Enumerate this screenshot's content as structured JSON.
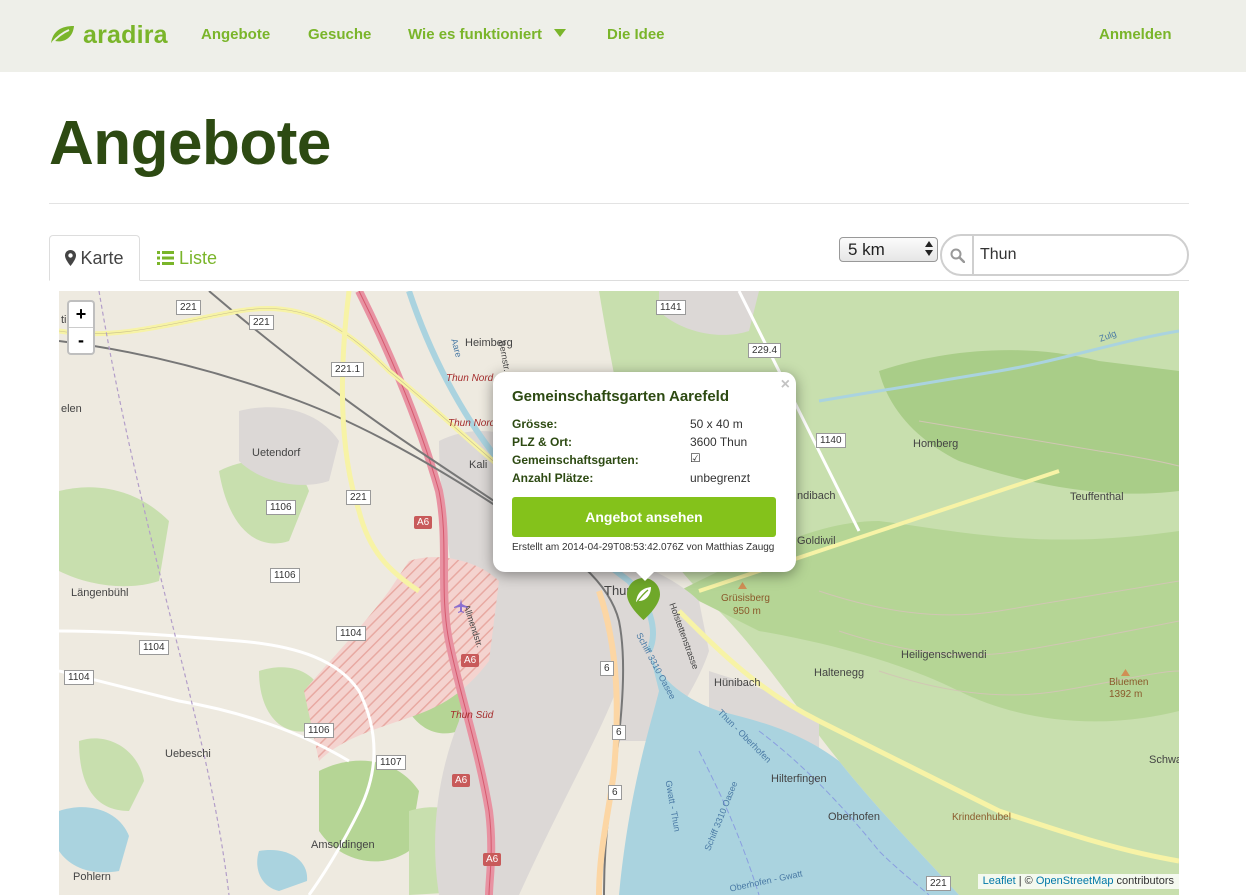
{
  "brand": {
    "name": "aradira",
    "icon": "leaf-icon"
  },
  "nav": {
    "items": [
      {
        "label": "Angebote"
      },
      {
        "label": "Gesuche"
      },
      {
        "label": "Wie es funktioniert"
      },
      {
        "label": "Die Idee"
      }
    ],
    "login": "Anmelden"
  },
  "page": {
    "title": "Angebote"
  },
  "tabs": [
    {
      "label": "Karte",
      "icon": "map-marker-icon",
      "active": true
    },
    {
      "label": "Liste",
      "icon": "list-icon",
      "active": false
    }
  ],
  "filter": {
    "radius": "5 km",
    "search_value": "Thun",
    "search_icon": "search-icon"
  },
  "map": {
    "zoom_in": "+",
    "zoom_out": "-",
    "attribution": {
      "leaflet": "Leaflet",
      "separator": " | © ",
      "osm": "OpenStreetMap",
      "suffix": " contributors"
    },
    "places": [
      "tigen",
      "Heimberg",
      "elen",
      "Uetendorf",
      "Kali",
      "Thun Nord",
      "Thun Nord",
      "Homberg",
      "Teuffenthal",
      "ndibach",
      "Goldiwil",
      "Grüsisberg",
      "950 m",
      "Längenbühl",
      "Heiligenschwendi",
      "Haltenegg",
      "Hünibach",
      "Bluemen",
      "1392 m",
      "Uebeschi",
      "Thun Süd",
      "Hilterfingen",
      "Oberhofen",
      "Krindenhubel",
      "Amsoldingen",
      "Pohlern",
      "Schwa",
      "Thun",
      "Aare",
      "Zulg",
      "Schiff 3310 Oasee",
      "Thun - Oberhofen",
      "Gwatt - Thun",
      "Schiff 3310 Oasee",
      "Oberhofen - Gwatt",
      "Allmendstr.",
      "Hofstettenstrasse",
      "Bernstr."
    ],
    "roads": [
      "221",
      "221",
      "221.1",
      "221",
      "1106",
      "1106",
      "1104",
      "1104",
      "1104",
      "1106",
      "1107",
      "1141",
      "229.4",
      "1140",
      "6",
      "6",
      "6",
      "221"
    ],
    "motorways": [
      "A6",
      "A6",
      "A6",
      "A6"
    ]
  },
  "popup": {
    "title": "Gemeinschaftsgarten Aarefeld",
    "close": "×",
    "rows": [
      {
        "label": "Grösse:",
        "value": "50 x 40 m"
      },
      {
        "label": "PLZ & Ort:",
        "value": "3600 Thun"
      },
      {
        "label": "Gemeinschaftsgarten:",
        "value": "☑"
      },
      {
        "label": "Anzahl Plätze:",
        "value": "unbegrenzt"
      }
    ],
    "button": "Angebot ansehen",
    "meta": "Erstellt am 2014-04-29T08:53:42.076Z von Matthias Zaugg"
  },
  "colors": {
    "brand": "#7ab52a",
    "title": "#2d4a12",
    "button": "#84c21b",
    "navbar": "#eeefe9"
  }
}
